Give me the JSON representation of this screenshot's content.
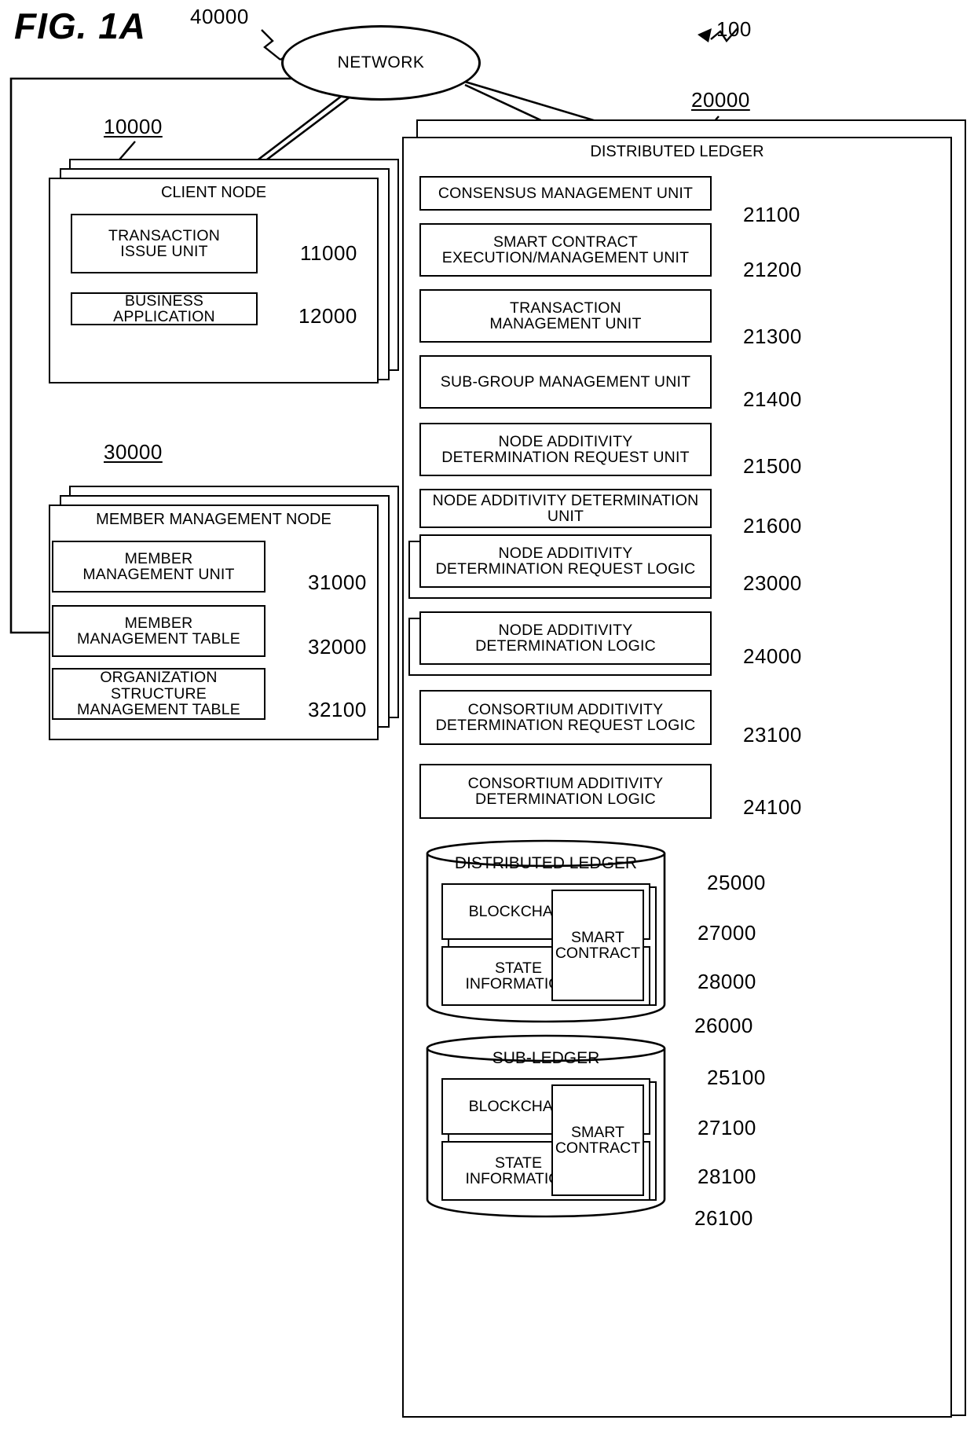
{
  "figure": {
    "title": "FIG. 1A",
    "system_ref": "100",
    "network_label": "NETWORK",
    "network_ref": "40000"
  },
  "client_node": {
    "ref": "10000",
    "title": "CLIENT NODE",
    "units": [
      {
        "label_line1": "TRANSACTION",
        "label_line2": "ISSUE UNIT",
        "ref": "11000"
      },
      {
        "label_line1": "BUSINESS APPLICATION",
        "label_line2": "",
        "ref": "12000"
      }
    ]
  },
  "member_management_node": {
    "ref": "30000",
    "title": "MEMBER MANAGEMENT NODE",
    "units": [
      {
        "label_line1": "MEMBER",
        "label_line2": "MANAGEMENT UNIT",
        "ref": "31000"
      },
      {
        "label_line1": "MEMBER",
        "label_line2": "MANAGEMENT TABLE",
        "ref": "32000"
      },
      {
        "label_line1": "ORGANIZATION STRUCTURE",
        "label_line2": "MANAGEMENT TABLE",
        "ref": "32100"
      }
    ]
  },
  "distributed_ledger_node": {
    "ref": "20000",
    "title": "DISTRIBUTED LEDGER",
    "units": [
      {
        "label_line1": "CONSENSUS MANAGEMENT UNIT",
        "label_line2": "",
        "ref": "21100",
        "stacked": false
      },
      {
        "label_line1": "SMART CONTRACT",
        "label_line2": "EXECUTION/MANAGEMENT UNIT",
        "ref": "21200",
        "stacked": false
      },
      {
        "label_line1": "TRANSACTION",
        "label_line2": "MANAGEMENT UNIT",
        "ref": "21300",
        "stacked": false
      },
      {
        "label_line1": "SUB-GROUP MANAGEMENT UNIT",
        "label_line2": "",
        "ref": "21400",
        "stacked": false
      },
      {
        "label_line1": "NODE ADDITIVITY",
        "label_line2": "DETERMINATION REQUEST UNIT",
        "ref": "21500",
        "stacked": false
      },
      {
        "label_line1": "NODE ADDITIVITY DETERMINATION UNIT",
        "label_line2": "",
        "ref": "21600",
        "stacked": false
      },
      {
        "label_line1": "NODE ADDITIVITY",
        "label_line2": "DETERMINATION REQUEST LOGIC",
        "ref": "23000",
        "stacked": true
      },
      {
        "label_line1": "NODE ADDITIVITY",
        "label_line2": "DETERMINATION LOGIC",
        "ref": "24000",
        "stacked": true
      },
      {
        "label_line1": "CONSORTIUM ADDITIVITY",
        "label_line2": "DETERMINATION REQUEST LOGIC",
        "ref": "23100",
        "stacked": false
      },
      {
        "label_line1": "CONSORTIUM ADDITIVITY",
        "label_line2": "DETERMINATION LOGIC",
        "ref": "24100",
        "stacked": false
      }
    ],
    "stores": [
      {
        "title": "DISTRIBUTED LEDGER",
        "title_ref": "25000",
        "blockchain_label": "BLOCKCHAIN",
        "blockchain_ref": "27000",
        "smart_contract_line1": "SMART",
        "smart_contract_line2": "CONTRACT",
        "state_line1": "STATE",
        "state_line2": "INFORMATION",
        "state_ref": "28000",
        "container_ref": "26000"
      },
      {
        "title": "SUB-LEDGER",
        "title_ref": "25100",
        "blockchain_label": "BLOCKCHAIN",
        "blockchain_ref": "27100",
        "smart_contract_line1": "SMART",
        "smart_contract_line2": "CONTRACT",
        "state_line1": "STATE",
        "state_line2": "INFORMATION",
        "state_ref": "28100",
        "container_ref": "26100"
      }
    ]
  }
}
